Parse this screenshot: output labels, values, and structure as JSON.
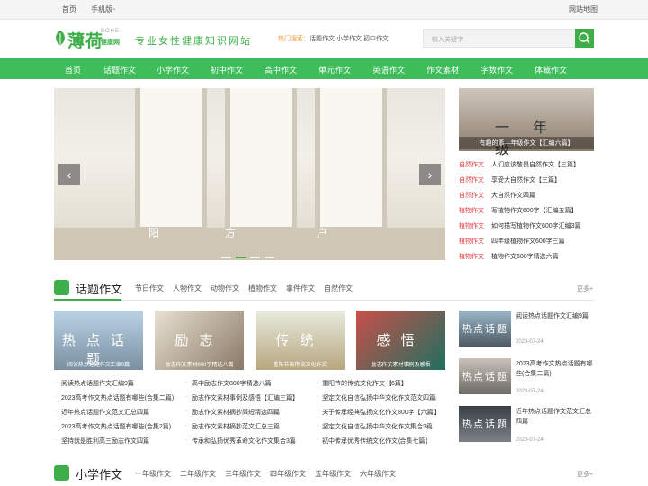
{
  "topbar": {
    "home": "首页",
    "mobile": "手机版",
    "sitemap": "网站地图"
  },
  "header": {
    "logo": "薄荷",
    "logo_en": "BOHE",
    "logo_cn": "健康网",
    "slogan": "专业女性健康知识网站",
    "hot_label": "热门搜索：",
    "hot_links": [
      "话题作文",
      "小学作文",
      "初中作文"
    ],
    "search_placeholder": "输入关键字"
  },
  "nav": [
    "首页",
    "话题作文",
    "小学作文",
    "初中作文",
    "高中作文",
    "单元作文",
    "英语作文",
    "作文素材",
    "字数作文",
    "体裁作文"
  ],
  "banner": {
    "caption_left": "阳",
    "caption_mid": "方",
    "caption_right": "户"
  },
  "side": {
    "image_big": "一年级",
    "image_caption": "有趣的事—年级作文【汇编六篇】",
    "list": [
      {
        "tag": "自然作文",
        "title": "人们应该敬畏自然作文【三篇】"
      },
      {
        "tag": "自然作文",
        "title": "享受大自然作文【三篇】"
      },
      {
        "tag": "自然作文",
        "title": "大自然作文四篇"
      },
      {
        "tag": "植物作文",
        "title": "写植物作文600字【汇编五篇】"
      },
      {
        "tag": "植物作文",
        "title": "如何描写植物作文600字汇编3篇"
      },
      {
        "tag": "植物作文",
        "title": "四年级植物作文600字三篇"
      },
      {
        "tag": "植物作文",
        "title": "植物作文600字精选六篇"
      }
    ]
  },
  "section1": {
    "title": "话题作文",
    "tags": [
      "节日作文",
      "人物作文",
      "动物作文",
      "植物作文",
      "事件作文",
      "自然作文"
    ],
    "more": "更多+",
    "thumbs": [
      {
        "text": "热点话题",
        "caption": "阅读热点话题作文汇编9篇"
      },
      {
        "text": "励志",
        "caption": "励志作文素材800字精选八篇"
      },
      {
        "text": "传统",
        "caption": "重阳节的传统文化作文"
      },
      {
        "text": "感悟",
        "caption": "励志作文素材事例及感悟"
      }
    ],
    "col1": [
      "阅读热点话题作文汇编9篇",
      "2023高考作文热点话题有哪些(合集二篇)",
      "近年热点话题作文范文汇总四篇",
      "2023高考作文热点话题有哪些(合集2篇)",
      "坚持就是胜利高三励志作文四篇"
    ],
    "col2": [
      "高中励志作文800字精选八篇",
      "励志作文素材事例及感悟【汇编三篇】",
      "励志作文素材摘抄简短精选四篇",
      "励志作文素材摘抄范文汇总三篇",
      "传承和弘扬优秀革命文化作文集合3篇"
    ],
    "col3": [
      "重阳节的传统文化作文【6篇】",
      "坚定文化自信弘扬中华文化作文范文四篇",
      "关于传承经典弘扬文化作文800字【六篇】",
      "坚定文化自信弘扬中华文化作文集合3篇",
      "初中传承优秀传统文化作文(合集七篇)"
    ],
    "right": [
      {
        "thumb": "热点话题",
        "title": "阅读热点话题作文汇编9篇",
        "date": "2023-07-24"
      },
      {
        "thumb": "热点话题",
        "title": "2023高考作文热点话题有哪些(合集二篇)",
        "date": "2023-07-24"
      },
      {
        "thumb": "热点话题",
        "title": "近年热点话题作文范文汇总四篇",
        "date": "2023-07-24"
      }
    ]
  },
  "section2": {
    "title": "小学作文",
    "tags": [
      "一年级作文",
      "二年级作文",
      "三年级作文",
      "四年级作文",
      "五年级作文",
      "六年级作文"
    ],
    "more": "更多+"
  }
}
